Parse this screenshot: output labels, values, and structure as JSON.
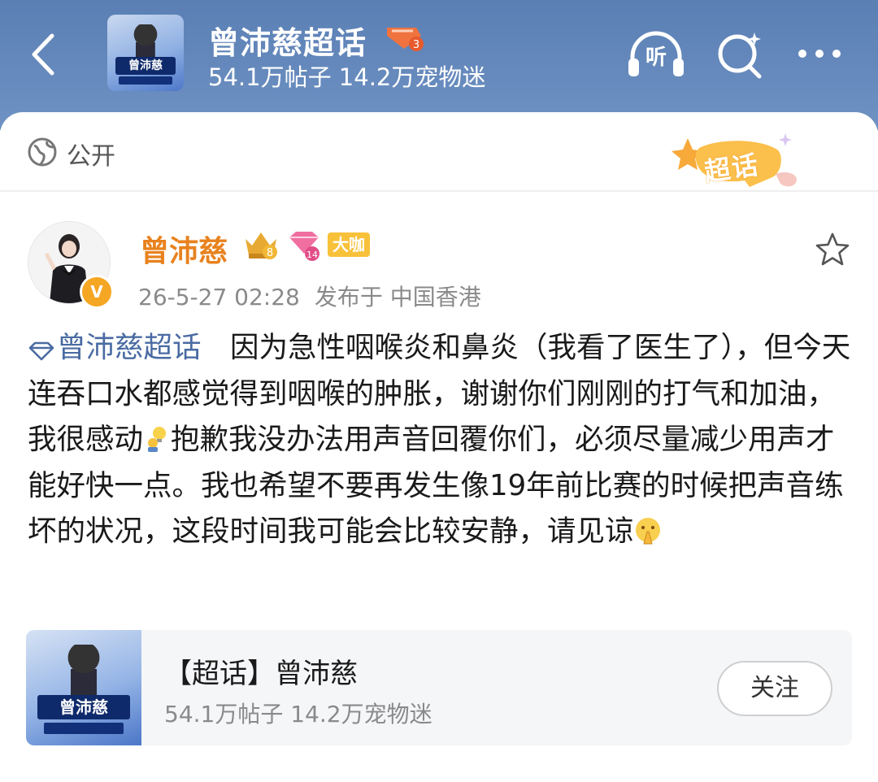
{
  "header": {
    "title": "曾沛慈超话",
    "level": "3",
    "stats": "54.1万帖子 14.2万宠物迷",
    "listen_label": "听",
    "cover_text": "曾沛慈"
  },
  "sheet": {
    "visibility": "公开",
    "sticker_text": "超话"
  },
  "post": {
    "author": "曾沛慈",
    "crown_level": "8",
    "gem_level": "14",
    "badge": "大咖",
    "verified_mark": "V",
    "timestamp": "26-5-27 02:28",
    "location": "发布于 中国香港",
    "topic_link": "曾沛慈超话",
    "text_1": "因为急性咽喉炎和鼻炎（我看了医生了），但今天连吞口水都感觉得到咽喉的肿胀，谢谢你们刚刚的打气和加油，我很感动",
    "text_2": "抱歉我没办法用声音回覆你们，必须尽量减少用声才能好快一点。我也希望不要再发生像19年前比赛的时候把声音练坏的状况，这段时间我可能会比较安静，请见谅",
    "emoji_1": "lightbulb-person-emoji",
    "emoji_2": "pray-emoji"
  },
  "topic_card": {
    "title": "【超话】曾沛慈",
    "stats": "54.1万帖子 14.2万宠物迷",
    "follow_label": "关注",
    "cover_text": "曾沛慈"
  },
  "colors": {
    "header_bg": "#5a7fb4",
    "author_name": "#e8821e",
    "topic_link": "#4a6ba3",
    "badge_yellow": "#f8c13a"
  }
}
